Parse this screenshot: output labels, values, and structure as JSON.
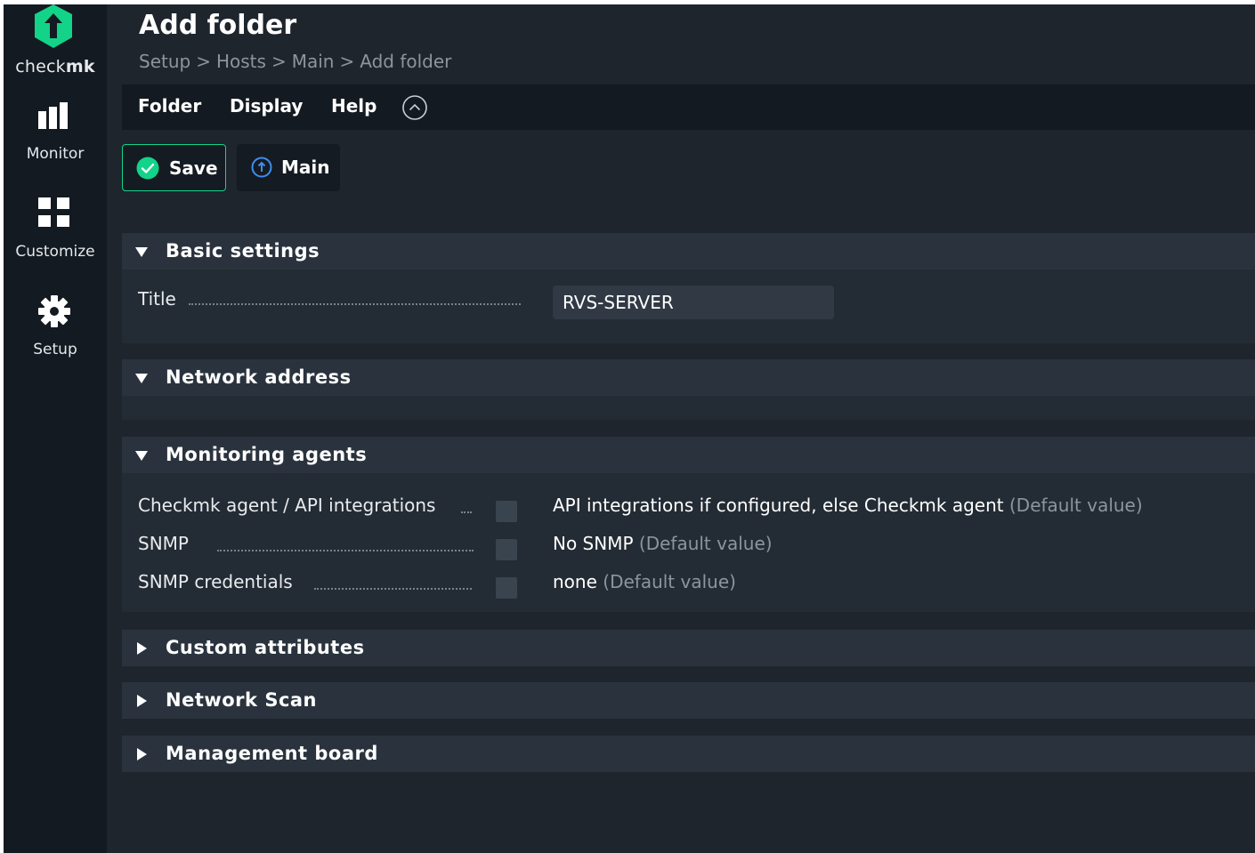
{
  "app": {
    "logo_text_light": "check",
    "logo_text_bold": "mk",
    "brand_color": "#13d389"
  },
  "sidebar": {
    "items": [
      {
        "label": "Monitor",
        "icon": "bar-chart-icon"
      },
      {
        "label": "Customize",
        "icon": "grid-icon"
      },
      {
        "label": "Setup",
        "icon": "gear-icon"
      }
    ]
  },
  "header": {
    "title": "Add folder",
    "breadcrumb": [
      "Setup",
      "Hosts",
      "Main",
      "Add folder"
    ],
    "separator": ">"
  },
  "menubar": {
    "items": [
      "Folder",
      "Display",
      "Help"
    ],
    "collapse_icon": "chevron-up-circle-icon"
  },
  "toolbar": {
    "save_label": "Save",
    "main_label": "Main"
  },
  "sections": {
    "basic": {
      "title": "Basic settings",
      "title_label": "Title",
      "title_value": "RVS-SERVER",
      "expanded": true
    },
    "network_address": {
      "title": "Network address",
      "expanded": true
    },
    "monitoring_agents": {
      "title": "Monitoring agents",
      "expanded": true,
      "rows": [
        {
          "label": "Checkmk agent / API integrations",
          "value": "API integrations if configured, else Checkmk agent",
          "default": "(Default value)"
        },
        {
          "label": "SNMP",
          "value": "No SNMP",
          "default": "(Default value)"
        },
        {
          "label": "SNMP credentials",
          "value": "none",
          "default": "(Default value)"
        }
      ]
    },
    "custom_attributes": {
      "title": "Custom attributes",
      "expanded": false
    },
    "network_scan": {
      "title": "Network Scan",
      "expanded": false
    },
    "management_board": {
      "title": "Management board",
      "expanded": false
    }
  }
}
